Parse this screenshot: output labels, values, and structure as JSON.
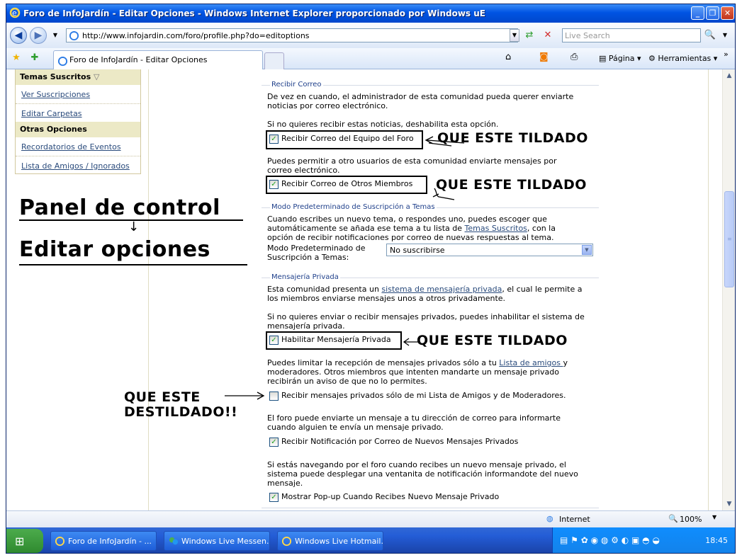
{
  "window": {
    "title": "Foro de InfoJardín - Editar Opciones - Windows Internet Explorer proporcionado por Windows uE"
  },
  "nav": {
    "address": "http://www.infojardin.com/foro/profile.php?do=editoptions",
    "search_placeholder": "Live Search"
  },
  "tab": {
    "label": "Foro de InfoJardín - Editar Opciones"
  },
  "cmd": {
    "page": "Página",
    "tools": "Herramientas"
  },
  "sidebar": {
    "head1": "Temas Suscritos",
    "links1": [
      "Ver Suscripciones",
      "Editar Carpetas"
    ],
    "head2": "Otras Opciones",
    "links2": [
      "Recordatorios de Eventos",
      "Lista de Amigos / Ignorados"
    ]
  },
  "annotations": {
    "panel": "Panel de control",
    "arrow_down": "↓",
    "editar": "Editar opciones",
    "tildado": "QUE ESTE TILDADO",
    "destildado_1": "QUE ESTE",
    "destildado_2": "DESTILDADO!!"
  },
  "recibir_correo": {
    "legend": "Recibir Correo",
    "text1": "De vez en cuando, el administrador de esta comunidad pueda querer enviarte noticias por correo electrónico.",
    "text2": "Si no quieres recibir estas noticias, deshabilita esta opción.",
    "chk1": "Recibir Correo del Equipo del Foro",
    "text3": "Puedes permitir a otro usuarios de esta comunidad enviarte mensajes por correo electrónico.",
    "chk2": "Recibir Correo de Otros Miembros"
  },
  "suscripcion": {
    "legend": "Modo Predeterminado de Suscripción a Temas",
    "text_a": "Cuando escribes un nuevo tema, o respondes uno, puedes escoger que automáticamente se añada ese tema a tu lista de ",
    "link": "Temas Suscritos",
    "text_b": ", con la opción de recibir notificaciones por correo de nuevas respuestas al tema.",
    "label": "Modo Predeterminado de Suscripción a Temas:",
    "select_value": "No suscribirse"
  },
  "mensajeria": {
    "legend": "Mensajería Privada",
    "text1_a": "Esta comunidad presenta un ",
    "text1_link": "sistema de mensajería privada",
    "text1_b": ", el cual le permite a los miembros enviarse mensajes unos a otros privadamente.",
    "text2": "Si no quieres enviar o recibir mensajes privados, puedes inhabilitar el sistema de mensajería privada.",
    "chk1": "Habilitar Mensajería Privada",
    "text3_a": "Puedes limitar la recepción de mensajes privados sólo a tu ",
    "text3_link": "Lista de amigos ",
    "text3_b": "y moderadores. Otros miembros que intenten mandarte un mensaje privado recibirán un aviso de que no lo permites.",
    "chk2": "Recibir mensajes privados sólo de mi Lista de Amigos y de Moderadores.",
    "text4": "El foro puede enviarte un mensaje a tu dirección de correo para informarte cuando alguien te envía un mensaje privado.",
    "chk3": "Recibir Notificación por Correo de Nuevos Mensajes Privados",
    "text5": "Si estás navegando por el foro cuando recibes un nuevo mensaje privado, el sistema puede desplegar una ventanita de notificación informandote del nuevo mensaje.",
    "chk4": "Mostrar Pop-up Cuando Recibes Nuevo Mensaje Privado"
  },
  "status": {
    "zone": "Internet",
    "zoom": "100%"
  },
  "taskbar": {
    "tasks": [
      "Foro de InfoJardín - ...",
      "Windows Live Messen...",
      "Windows Live Hotmail..."
    ],
    "clock": "18:45"
  }
}
